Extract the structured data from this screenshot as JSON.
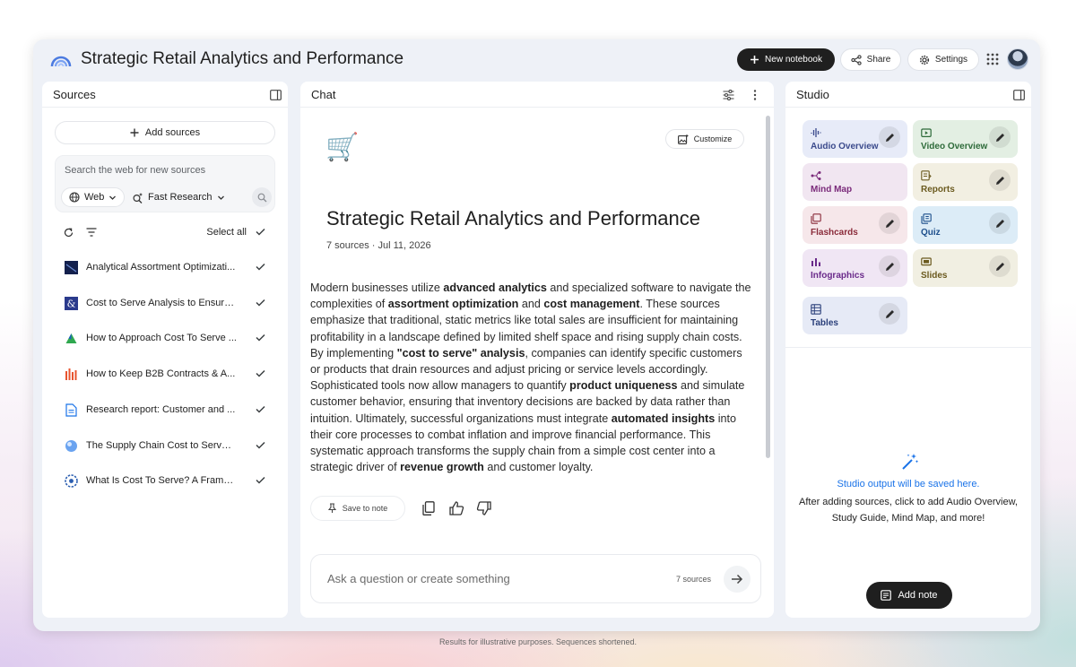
{
  "header": {
    "title": "Strategic Retail Analytics and Performance",
    "new_notebook_label": "New notebook",
    "share_label": "Share",
    "settings_label": "Settings"
  },
  "sources": {
    "title": "Sources",
    "add_label": "Add sources",
    "search_placeholder": "Search the web for new sources",
    "web_chip": "Web",
    "research_chip": "Fast Research",
    "select_all": "Select all",
    "items": [
      {
        "label": "Analytical Assortment Optimizati...",
        "icon": "navy-square-icon"
      },
      {
        "label": "Cost to Serve Analysis to Ensure ...",
        "icon": "ampersand-icon"
      },
      {
        "label": "How to Approach Cost To Serve ...",
        "icon": "green-triangle-icon"
      },
      {
        "label": "How to Keep B2B Contracts & A...",
        "icon": "bar-logo-icon"
      },
      {
        "label": "Research report: Customer and ...",
        "icon": "document-icon"
      },
      {
        "label": "The Supply Chain Cost to Serve ...",
        "icon": "globe-icon"
      },
      {
        "label": "What Is Cost To Serve? A Frame...",
        "icon": "flower-logo-icon"
      }
    ]
  },
  "chat": {
    "title": "Chat",
    "customize_label": "Customize",
    "notebook_title": "Strategic Retail Analytics and Performance",
    "meta": "7 sources · Jul 11, 2026",
    "summary": {
      "p1": "Modern businesses utilize ",
      "b1": "advanced analytics",
      "p2": " and specialized software to navigate the complexities of ",
      "b2": "assortment optimization",
      "p3": " and ",
      "b3": "cost management",
      "p4": ". These sources emphasize that traditional, static metrics like total sales are insufficient for maintaining profitability in a landscape defined by limited shelf space and rising supply chain costs. By implementing ",
      "b4": "\"cost to serve\" analysis",
      "p5": ", companies can identify specific customers or products that drain resources and adjust pricing or service levels accordingly. Sophisticated tools now allow managers to quantify ",
      "b5": "product uniqueness",
      "p6": " and simulate customer behavior, ensuring that inventory decisions are backed by data rather than intuition. Ultimately, successful organizations must integrate ",
      "b6": "automated insights",
      "p7": " into their core processes to combat inflation and improve financial performance. This systematic approach transforms the supply chain from a simple cost center into a strategic driver of ",
      "b7": "revenue growth",
      "p8": " and customer loyalty."
    },
    "save_note_label": "Save to note",
    "ask_placeholder": "Ask a question or create something",
    "source_count": "7 sources"
  },
  "studio": {
    "title": "Studio",
    "tiles": [
      {
        "label": "Audio Overview",
        "color": "#3b4a8c",
        "bg": "#e7ebf8",
        "icon": "audio-wave-icon"
      },
      {
        "label": "Video Overview",
        "color": "#2e6b3a",
        "bg": "#e3efe3",
        "icon": "video-icon"
      },
      {
        "label": "Mind Map",
        "color": "#7a2a7a",
        "bg": "#f1e6f1",
        "icon": "mind-map-icon"
      },
      {
        "label": "Reports",
        "color": "#6b5a1f",
        "bg": "#f2efe2",
        "icon": "reports-icon"
      },
      {
        "label": "Flashcards",
        "color": "#8a2b3a",
        "bg": "#f6e7ea",
        "icon": "flashcards-icon"
      },
      {
        "label": "Quiz",
        "color": "#1d4f8c",
        "bg": "#dcecf7",
        "icon": "quiz-icon"
      },
      {
        "label": "Infographics",
        "color": "#6a2a8a",
        "bg": "#f0e6f4",
        "icon": "infographics-icon"
      },
      {
        "label": "Slides",
        "color": "#6b5a1f",
        "bg": "#f1efe2",
        "icon": "slides-icon"
      },
      {
        "label": "Tables",
        "color": "#2a3f7a",
        "bg": "#e6eaf6",
        "icon": "tables-icon"
      }
    ],
    "output_title": "Studio output will be saved here.",
    "output_desc": "After adding sources, click to add Audio Overview, Study Guide, Mind Map, and more!",
    "add_note_label": "Add note"
  },
  "footnote": "Results for illustrative purposes. Sequences shortened."
}
